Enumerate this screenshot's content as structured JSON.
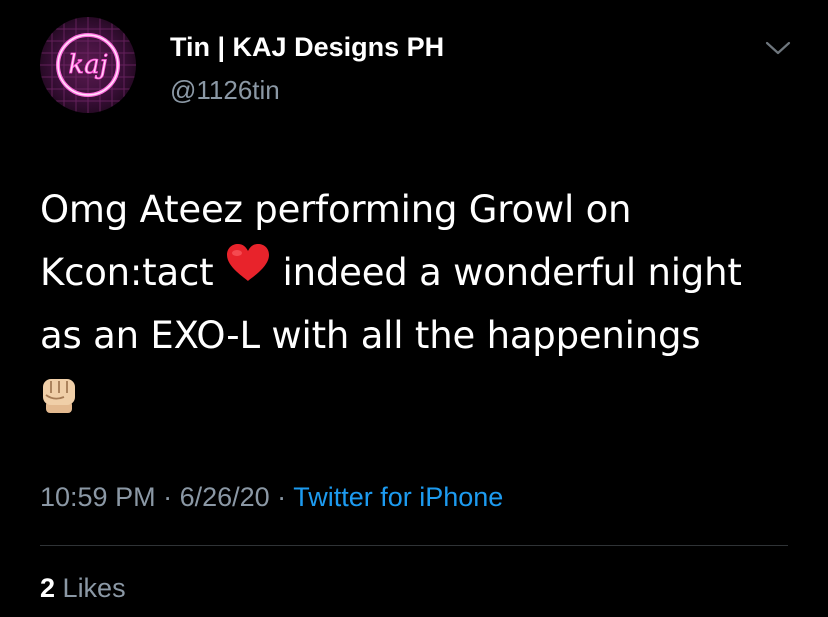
{
  "author": {
    "display_name": "Tin | KAJ Designs PH",
    "handle": "@1126tin",
    "avatar_text": "kaj"
  },
  "tweet": {
    "lines": [
      "Omg Ateez performing Growl on",
      "Kcon:tact",
      "indeed a wonderful night",
      "as an EXO-L with all the happenings"
    ],
    "emojis": [
      "red-heart-emoji",
      "raised-fist-emoji"
    ]
  },
  "meta": {
    "time": "10:59 PM",
    "separator": " · ",
    "date": "6/26/20",
    "source": "Twitter for iPhone"
  },
  "stats": {
    "likes_count": "2",
    "likes_label": "Likes"
  },
  "colors": {
    "background": "#000000",
    "text": "#ffffff",
    "secondary": "#8b98a5",
    "link": "#1d9bf0",
    "avatar_neon": "#ff3fd2"
  }
}
